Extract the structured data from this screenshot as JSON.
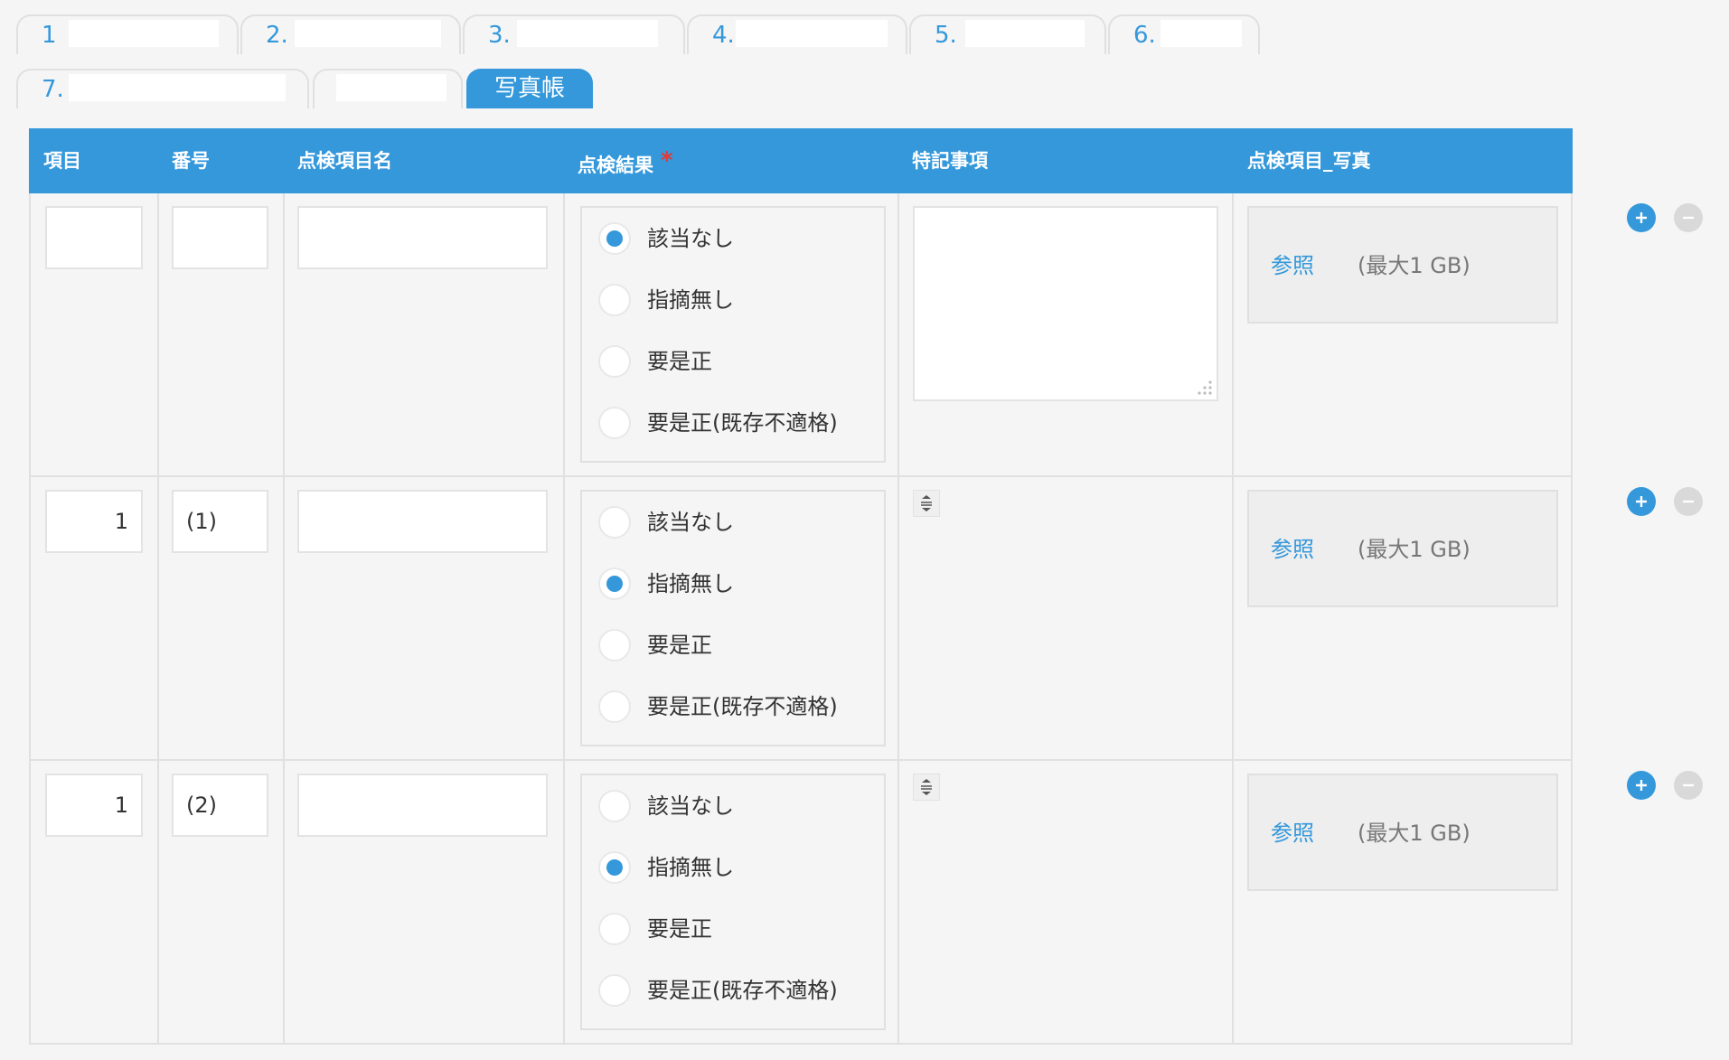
{
  "tabs": {
    "row1": [
      {
        "label": "1"
      },
      {
        "label": "2."
      },
      {
        "label": "3."
      },
      {
        "label": "4."
      },
      {
        "label": "5."
      },
      {
        "label": "6."
      }
    ],
    "row2": [
      {
        "label": "7."
      },
      {
        "label": ""
      },
      {
        "label": "写真帳",
        "active": true
      }
    ]
  },
  "table": {
    "headers": {
      "item": "項目",
      "number": "番号",
      "name": "点検項目名",
      "result": "点検結果",
      "result_required": "*",
      "notes": "特記事項",
      "photo": "点検項目_写真"
    },
    "options": [
      "該当なし",
      "指摘無し",
      "要是正",
      "要是正(既存不適格)"
    ],
    "browse_label": "参照",
    "max_size_label": "(最大1 GB)",
    "rows": [
      {
        "item": "",
        "number": "",
        "name": "",
        "selected": "該当なし",
        "notes_expanded": true
      },
      {
        "item": "1",
        "number": "(1)",
        "name": "",
        "selected": "指摘無し",
        "notes_expanded": false
      },
      {
        "item": "1",
        "number": "(2)",
        "name": "",
        "selected": "指摘無し",
        "notes_expanded": false
      }
    ]
  },
  "colors": {
    "accent": "#3498db",
    "required": "#e53935",
    "background": "#f5f5f5"
  },
  "icons": {
    "add": "plus-circle-icon",
    "remove": "minus-circle-icon",
    "expand": "expand-vertical-icon",
    "resize": "resize-grip-icon"
  }
}
